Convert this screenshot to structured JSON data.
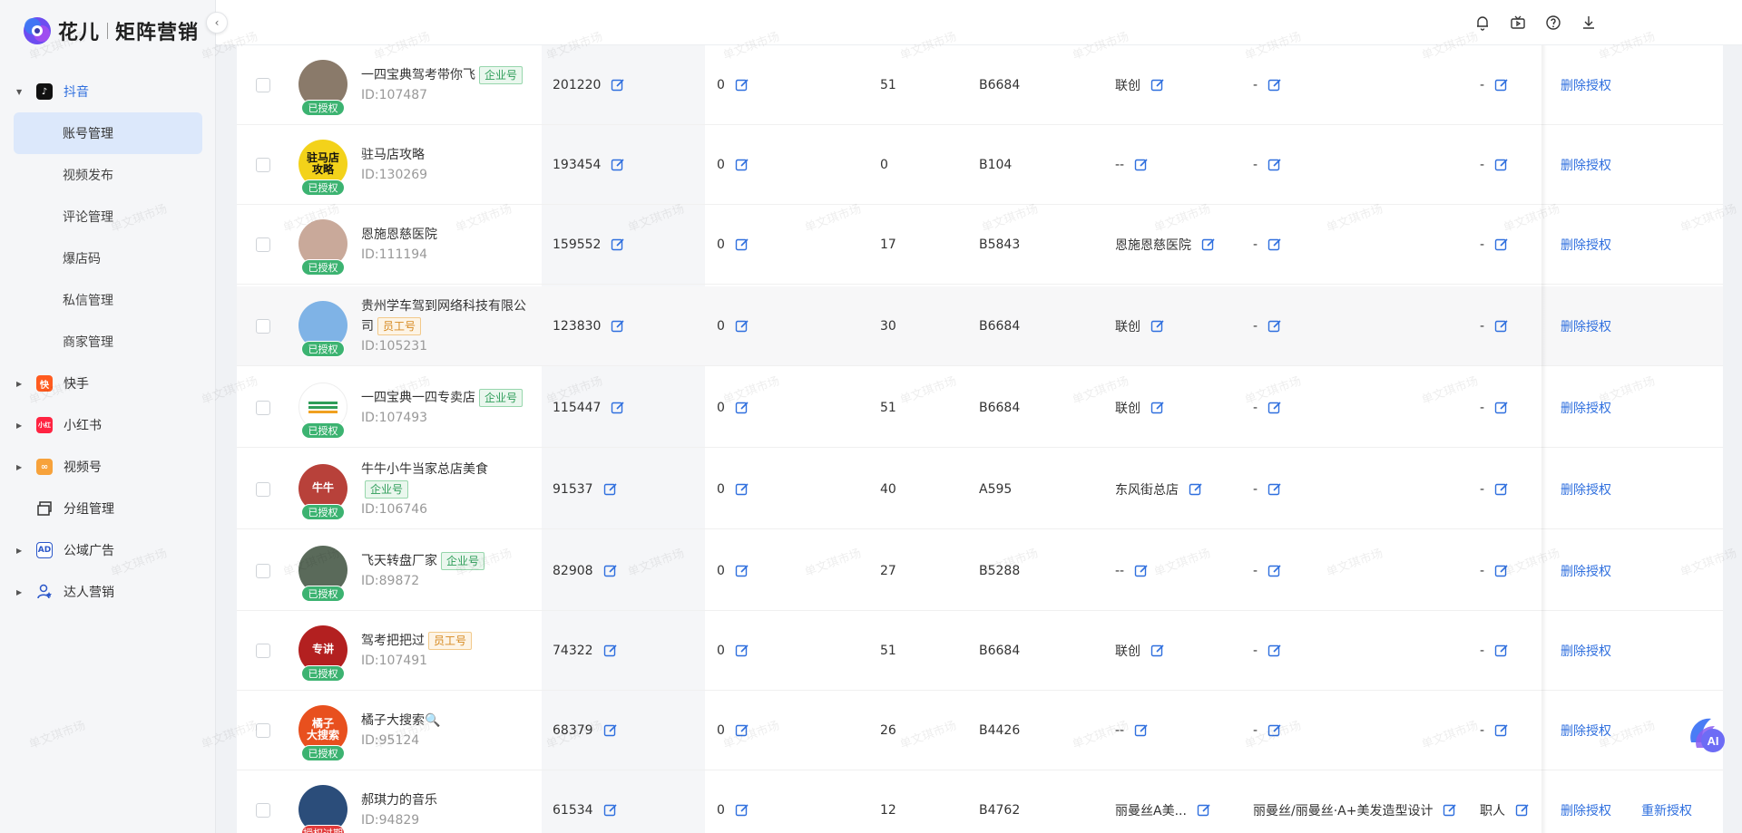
{
  "brand": {
    "name": "花儿",
    "product": "矩阵营销"
  },
  "colors": {
    "accent": "#2f6fde",
    "authorized": "#3cb371",
    "expired": "#e23b3b"
  },
  "sidebar": {
    "groups": [
      {
        "label": "抖音",
        "icon": "douyin-icon",
        "expanded": true,
        "items": [
          "账号管理",
          "视频发布",
          "评论管理",
          "爆店码",
          "私信管理",
          "商家管理"
        ]
      },
      {
        "label": "快手",
        "icon": "kuaishou-icon"
      },
      {
        "label": "小红书",
        "icon": "xiaohongshu-icon"
      },
      {
        "label": "视频号",
        "icon": "shipinhao-icon"
      },
      {
        "label": "分组管理",
        "icon": "group-icon"
      },
      {
        "label": "公域广告",
        "icon": "ad-icon"
      },
      {
        "label": "达人营销",
        "icon": "influencer-icon"
      }
    ],
    "selected": "账号管理"
  },
  "header": {
    "icons": [
      "bell-icon",
      "tv-icon",
      "help-icon",
      "download-icon"
    ]
  },
  "watermark": "单文琪市场",
  "rows": [
    {
      "name": "一四宝典驾考带你飞",
      "tag": "企业号",
      "tag_type": "ent",
      "id": "ID:107487",
      "fans": "201220",
      "c2": "0",
      "c3": "51",
      "code": "B6684",
      "c5": "联创",
      "c6": "-",
      "c7": "-",
      "status": "已授权",
      "actions": [
        "删除授权"
      ]
    },
    {
      "name": "驻马店攻略",
      "tag": "",
      "tag_type": "",
      "id": "ID:130269",
      "fans": "193454",
      "c2": "0",
      "c3": "0",
      "code": "B104",
      "c5": "--",
      "c6": "-",
      "c7": "-",
      "status": "已授权",
      "actions": [
        "删除授权"
      ]
    },
    {
      "name": "恩施恩慈医院",
      "tag": "",
      "tag_type": "",
      "id": "ID:111194",
      "fans": "159552",
      "c2": "0",
      "c3": "17",
      "code": "B5843",
      "c5": "恩施恩慈医院",
      "c6": "-",
      "c7": "-",
      "status": "已授权",
      "actions": [
        "删除授权"
      ]
    },
    {
      "name": "贵州学车驾到网络科技有限公司",
      "tag": "员工号",
      "tag_type": "emp",
      "id": "ID:105231",
      "fans": "123830",
      "c2": "0",
      "c3": "30",
      "code": "B6684",
      "c5": "联创",
      "c6": "-",
      "c7": "-",
      "status": "已授权",
      "actions": [
        "删除授权"
      ]
    },
    {
      "name": "一四宝典一四专卖店",
      "tag": "企业号",
      "tag_type": "ent",
      "id": "ID:107493",
      "fans": "115447",
      "c2": "0",
      "c3": "51",
      "code": "B6684",
      "c5": "联创",
      "c6": "-",
      "c7": "-",
      "status": "已授权",
      "actions": [
        "删除授权"
      ]
    },
    {
      "name": "牛牛小牛当家总店美食",
      "tag": "企业号",
      "tag_type": "ent",
      "id": "ID:106746",
      "fans": "91537",
      "c2": "0",
      "c3": "40",
      "code": "A595",
      "c5": "东风街总店",
      "c6": "-",
      "c7": "-",
      "status": "已授权",
      "actions": [
        "删除授权"
      ]
    },
    {
      "name": "飞天转盘厂家",
      "tag": "企业号",
      "tag_type": "ent",
      "id": "ID:89872",
      "fans": "82908",
      "c2": "0",
      "c3": "27",
      "code": "B5288",
      "c5": "--",
      "c6": "-",
      "c7": "-",
      "status": "已授权",
      "actions": [
        "删除授权"
      ]
    },
    {
      "name": "驾考把把过",
      "tag": "员工号",
      "tag_type": "emp",
      "id": "ID:107491",
      "fans": "74322",
      "c2": "0",
      "c3": "51",
      "code": "B6684",
      "c5": "联创",
      "c6": "-",
      "c7": "-",
      "status": "已授权",
      "actions": [
        "删除授权"
      ]
    },
    {
      "name": "橘子大搜索🔍",
      "tag": "",
      "tag_type": "",
      "id": "ID:95124",
      "fans": "68379",
      "c2": "0",
      "c3": "26",
      "code": "B4426",
      "c5": "--",
      "c6": "-",
      "c7": "-",
      "status": "已授权",
      "actions": [
        "删除授权"
      ]
    },
    {
      "name": "郝琪力的音乐",
      "tag": "",
      "tag_type": "",
      "id": "ID:94829",
      "fans": "61534",
      "c2": "0",
      "c3": "12",
      "code": "B4762",
      "c5": "丽曼丝A美...",
      "c6": "丽曼丝/丽曼丝·A+美发造型设计",
      "c7": "职人",
      "status": "授权过期",
      "actions": [
        "删除授权",
        "重新授权"
      ]
    }
  ],
  "avatars": [
    {
      "bg": "#8a7a6a",
      "text": ""
    },
    {
      "bg": "#f3d21a",
      "text": "驻马店\n攻略"
    },
    {
      "bg": "#c9a99a",
      "text": ""
    },
    {
      "bg": "#7fb3e6",
      "text": ""
    },
    {
      "bg": "#ffffff",
      "text": ""
    },
    {
      "bg": "#b8413a",
      "text": "牛牛"
    },
    {
      "bg": "#5a6a5a",
      "text": ""
    },
    {
      "bg": "#b32020",
      "text": "专讲"
    },
    {
      "bg": "#e8501e",
      "text": "橘子\n大搜索"
    },
    {
      "bg": "#2b4d7a",
      "text": ""
    }
  ]
}
